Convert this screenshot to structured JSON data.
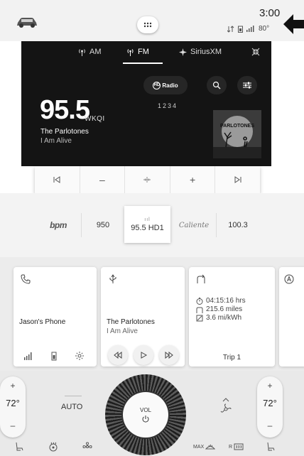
{
  "status_bar": {
    "time": "3:00",
    "temperature": "80°",
    "icons": [
      "car-icon",
      "apps-grid-icon",
      "gps-arrows-icon",
      "phone-battery-icon",
      "signal-icon",
      "pointer-arrow-icon"
    ]
  },
  "radio": {
    "tabs": [
      {
        "label": "AM",
        "icon": "am-antenna-icon"
      },
      {
        "label": "FM",
        "icon": "fm-antenna-icon",
        "active": true
      },
      {
        "label": "SiriusXM",
        "icon": "siriusxm-icon"
      }
    ],
    "hd_button": {
      "prefix": "HD",
      "label": "Radio"
    },
    "hd_channels": "1234",
    "frequency": "95.5",
    "callsign": "WKQI",
    "artist": "The Parlotones",
    "song": "I Am Alive",
    "album_art_text": "PARLOTONES"
  },
  "tuner": {
    "buttons": [
      "seek-back-icon",
      "tune-down-icon",
      "scan-icon",
      "tune-up-icon",
      "seek-forward-icon"
    ],
    "minus_glyph": "–",
    "plus_glyph": "+"
  },
  "presets": [
    {
      "label": "bpm",
      "type": "logo"
    },
    {
      "label": "950"
    },
    {
      "label": "95.5 HD1",
      "selected": true,
      "indicator": "ııl"
    },
    {
      "label": "Caliente",
      "type": "logo"
    },
    {
      "label": "100.3"
    }
  ],
  "cards": {
    "phone": {
      "title": "Jason's Phone"
    },
    "media": {
      "title": "The Parlotones",
      "subtitle": "I Am Alive"
    },
    "trip": {
      "time": "04:15:16 hrs",
      "distance": "215.6 miles",
      "efficiency": "3.6 mi/kWh",
      "label": "Trip 1"
    }
  },
  "climate": {
    "left_temp": "72°",
    "right_temp": "72°",
    "plus": "+",
    "minus": "–",
    "mode": "AUTO",
    "vol_label": "VOL",
    "max_label": "MAX",
    "rear_label": "R"
  },
  "colors": {
    "panel_bg": "#141414",
    "accent": "#ffffff",
    "surface": "#f3f3f3"
  }
}
